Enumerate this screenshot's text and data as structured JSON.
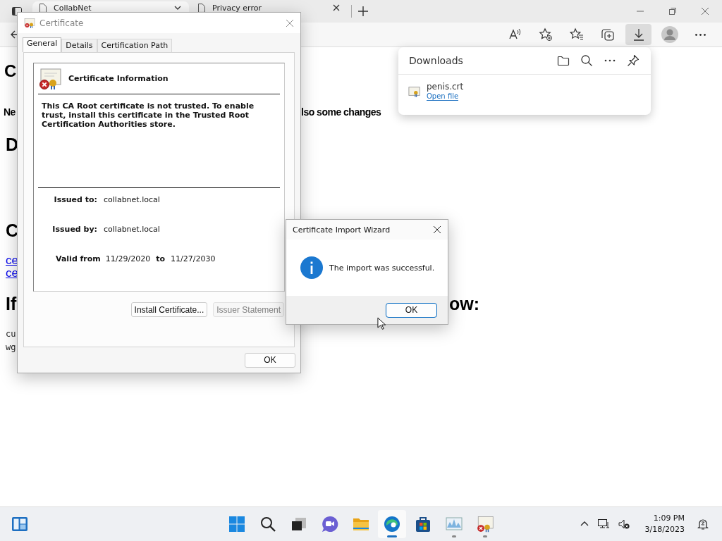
{
  "browser": {
    "tabs": [
      {
        "title": "CollabNet",
        "selected": true
      },
      {
        "title": "Privacy error",
        "selected": false
      }
    ],
    "toolbar": [
      {
        "kind": "read-aloud",
        "selected": false
      },
      {
        "kind": "add-favorite",
        "selected": false
      },
      {
        "kind": "favorites",
        "selected": false
      },
      {
        "kind": "collections",
        "selected": false
      },
      {
        "kind": "downloads",
        "selected": true
      },
      {
        "kind": "profile",
        "selected": false
      },
      {
        "kind": "more",
        "selected": false
      }
    ]
  },
  "page": {
    "fragments": [
      {
        "kind": "heading1",
        "text": "C"
      },
      {
        "kind": "bold",
        "text": "Ne"
      },
      {
        "kind": "bold",
        "text": "lso some changes"
      },
      {
        "kind": "heading2",
        "text": "D"
      },
      {
        "kind": "heading2",
        "text": "C"
      },
      {
        "kind": "link",
        "text": "ce"
      },
      {
        "kind": "link",
        "text": "ce"
      },
      {
        "kind": "heading2",
        "text": "If"
      },
      {
        "kind": "heading2",
        "text": "ow:"
      },
      {
        "kind": "code",
        "text": "cu"
      },
      {
        "kind": "code",
        "text": "wg"
      }
    ]
  },
  "downloads": {
    "title": "Downloads",
    "items": [
      {
        "name": "penis.crt",
        "action": "Open file"
      }
    ]
  },
  "certificate_dialog": {
    "title": "Certificate",
    "tabs": [
      {
        "label": "General",
        "selected": true
      },
      {
        "label": "Details",
        "selected": false
      },
      {
        "label": "Certification Path",
        "selected": false
      }
    ],
    "info_title": "Certificate Information",
    "message": "This CA Root certificate is not trusted. To enable trust, install this certificate in the Trusted Root Certification Authorities store.",
    "fields": [
      {
        "label": "Issued to:",
        "value": "collabnet.local"
      },
      {
        "label": "Issued by:",
        "value": "collabnet.local"
      }
    ],
    "valid_from_label": "Valid from",
    "valid_from": "11/29/2020",
    "to_label": "to",
    "valid_to": "11/27/2030",
    "buttons": [
      {
        "label": "Install Certificate...",
        "disabled": false
      },
      {
        "label": "Issuer Statement",
        "disabled": true
      }
    ],
    "ok": "OK"
  },
  "wizard": {
    "title": "Certificate Import Wizard",
    "message": "The import was successful.",
    "ok": "OK"
  },
  "taskbar": {
    "apps": [
      {
        "kind": "start",
        "running": false,
        "selected": false
      },
      {
        "kind": "search",
        "running": false,
        "selected": false
      },
      {
        "kind": "task-view",
        "running": false,
        "selected": false
      },
      {
        "kind": "chat",
        "running": false,
        "selected": false
      },
      {
        "kind": "explorer",
        "running": false,
        "selected": false
      },
      {
        "kind": "edge",
        "running": true,
        "selected": true
      },
      {
        "kind": "store",
        "running": false,
        "selected": false
      },
      {
        "kind": "monitor",
        "running": true,
        "selected": false
      },
      {
        "kind": "certificate",
        "running": true,
        "selected": false
      }
    ],
    "clock": {
      "time": "1:09 PM",
      "date": "3/18/2023"
    }
  }
}
